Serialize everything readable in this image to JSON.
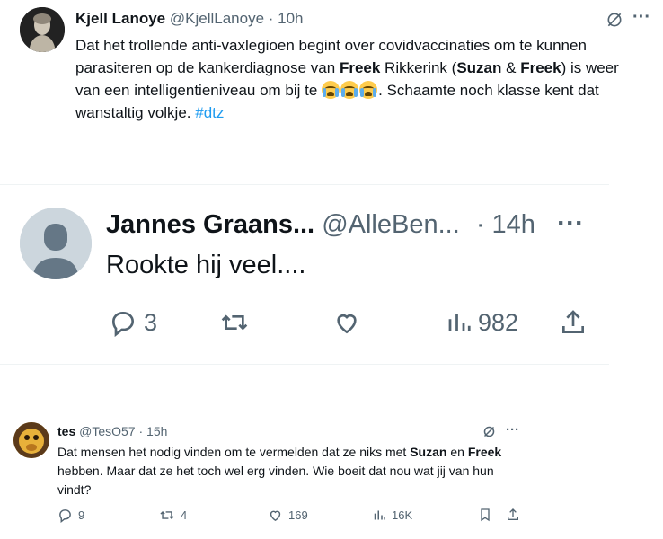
{
  "tweet1": {
    "name": "Kjell Lanoye",
    "handle": "@KjellLanoye",
    "time": "· 10h",
    "text_parts": {
      "a": "Dat het trollende anti-vaxlegioen begint over covidvaccinaties om te kunnen parasiteren op de kankerdiagnose van ",
      "b": "Freek",
      "c": " Rikkerink (",
      "d": "Suzan",
      "e": " & ",
      "f": "Freek",
      "g": ") is weer van een intelligentieniveau om bij te ",
      "h": ". Schaamte noch klasse kent dat wanstaltig volkje. ",
      "hashtag": "#dtz"
    },
    "more": "···"
  },
  "tweet2": {
    "name": "Jannes Graans...",
    "handle": "@AlleBen...",
    "time": "· 14h",
    "text": "Rookte hij veel....",
    "replies": "3",
    "views": "982",
    "more": "···"
  },
  "tweet3": {
    "name": "tes",
    "handle": "@TesO57",
    "time": "· 15h",
    "text_parts": {
      "a": "Dat mensen het nodig vinden om te vermelden dat ze niks met ",
      "b": "Suzan",
      "c": " en ",
      "d": "Freek",
      "e": " hebben. Maar dat ze het toch wel erg vinden. Wie boeit dat nou wat jij van hun vindt?"
    },
    "replies": "9",
    "retweets": "4",
    "likes": "169",
    "views": "16K",
    "more": "···"
  },
  "colors": {
    "muted": "#536471",
    "link": "#1d9bf0",
    "text": "#0f1419"
  },
  "icons": [
    "grok-icon",
    "reply-icon",
    "retweet-icon",
    "like-icon",
    "views-icon",
    "share-icon",
    "bookmark-icon"
  ]
}
